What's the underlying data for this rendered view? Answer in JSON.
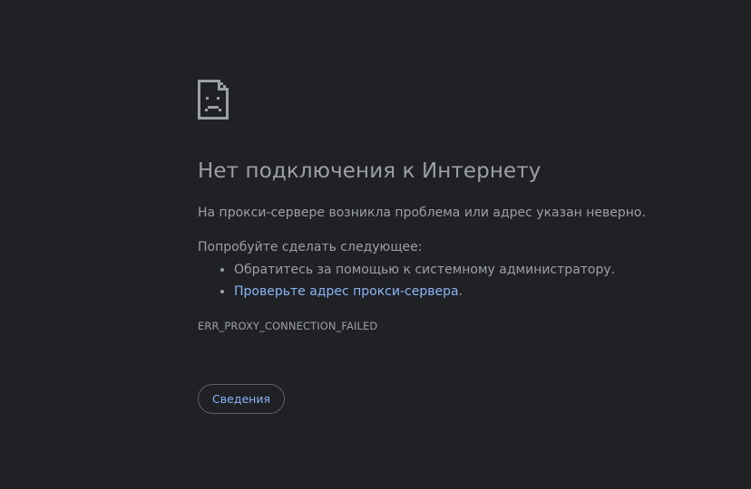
{
  "icon": "sad-page-icon",
  "title": "Нет подключения к Интернету",
  "summary": "На прокси-сервере возникла проблема или адрес указан неверно.",
  "try_heading": "Попробуйте сделать следующее:",
  "suggestions": {
    "contact_admin": "Обратитесь за помощью к системному администратору.",
    "check_proxy_link": "Проверьте адрес прокси-сервера",
    "check_proxy_suffix": "."
  },
  "error_code": "ERR_PROXY_CONNECTION_FAILED",
  "details_button_label": "Сведения",
  "colors": {
    "background": "#202124",
    "text": "#9aa0a6",
    "link": "#8ab4f8",
    "button_border": "#5f6368"
  }
}
